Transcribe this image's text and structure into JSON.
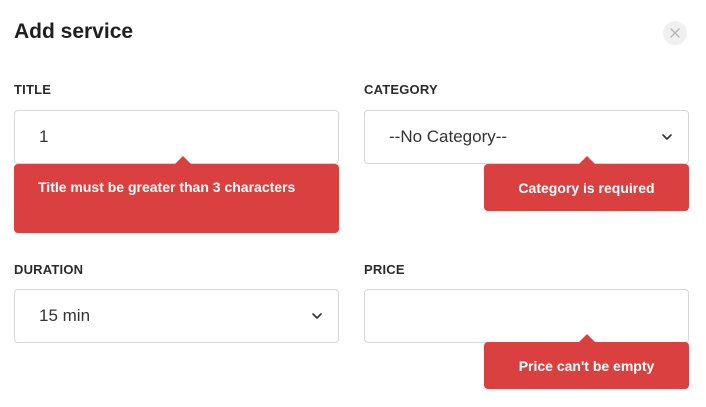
{
  "modal": {
    "title": "Add service",
    "close_icon": "close-icon"
  },
  "fields": {
    "title": {
      "label": "TITLE",
      "value": "1",
      "error": "Title must be greater than 3 characters"
    },
    "category": {
      "label": "CATEGORY",
      "selected": "--No Category--",
      "error": "Category is required"
    },
    "duration": {
      "label": "DURATION",
      "selected": "15 min"
    },
    "price": {
      "label": "PRICE",
      "value": "",
      "error": "Price can't be empty"
    }
  },
  "colors": {
    "error": "#d9403f",
    "border": "#d6d6d6"
  }
}
